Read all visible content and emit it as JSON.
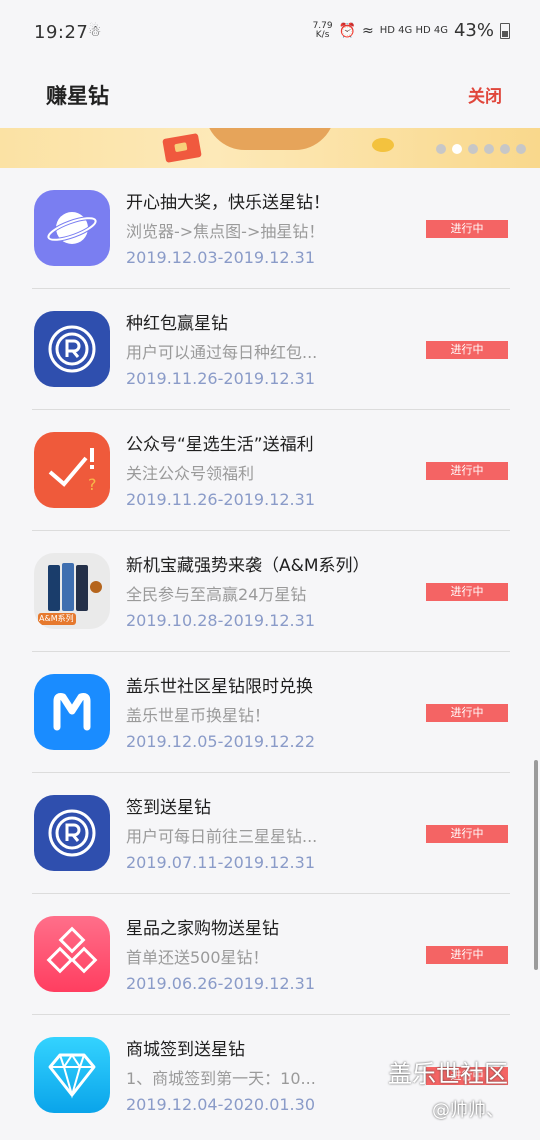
{
  "status": {
    "time": "19:27",
    "speed": "7.79\nK/s",
    "signal_text": "HD 4G HD 4G",
    "battery": "43%"
  },
  "header": {
    "title": "赚星钻",
    "close_label": "关闭"
  },
  "items": [
    {
      "title": "开心抽大奖，快乐送星钻！",
      "desc": "浏览器->焦点图->抽星钻！",
      "date": "2019.12.03-2019.12.31",
      "status": "进行中",
      "icon": "internet-planet-icon"
    },
    {
      "title": "种红包赢星钻",
      "desc": "用户可以通过每日种红包...",
      "date": "2019.11.26-2019.12.31",
      "status": "进行中",
      "icon": "rewards-r-icon"
    },
    {
      "title": "公众号“星选生活”送福利",
      "desc": "关注公众号领福利",
      "date": "2019.11.26-2019.12.31",
      "status": "进行中",
      "icon": "check-exclaim-icon"
    },
    {
      "title": "新机宝藏强势来袭（A&M系列）",
      "desc": "全民参与至高赢24万星钻",
      "date": "2019.10.28-2019.12.31",
      "status": "进行中",
      "icon": "phones-icon",
      "icon_tag": "A&M系列"
    },
    {
      "title": "盖乐世社区星钻限时兑换",
      "desc": "盖乐世星币换星钻！",
      "date": "2019.12.05-2019.12.22",
      "status": "进行中",
      "icon": "members-m-icon"
    },
    {
      "title": "签到送星钻",
      "desc": "用户可每日前往三星星钻...",
      "date": "2019.07.11-2019.12.31",
      "status": "进行中",
      "icon": "rewards-r-icon"
    },
    {
      "title": "星品之家购物送星钻",
      "desc": "首单还送500星钻！",
      "date": "2019.06.26-2019.12.31",
      "status": "进行中",
      "icon": "diamonds-icon"
    },
    {
      "title": "商城签到送星钻",
      "desc": "1、商城签到第一天：10...",
      "date": "2019.12.04-2020.01.30",
      "status": "进行中",
      "icon": "gem-icon"
    }
  ],
  "watermark": {
    "line1": "盖乐世社区",
    "line2": "@帅帅、"
  }
}
